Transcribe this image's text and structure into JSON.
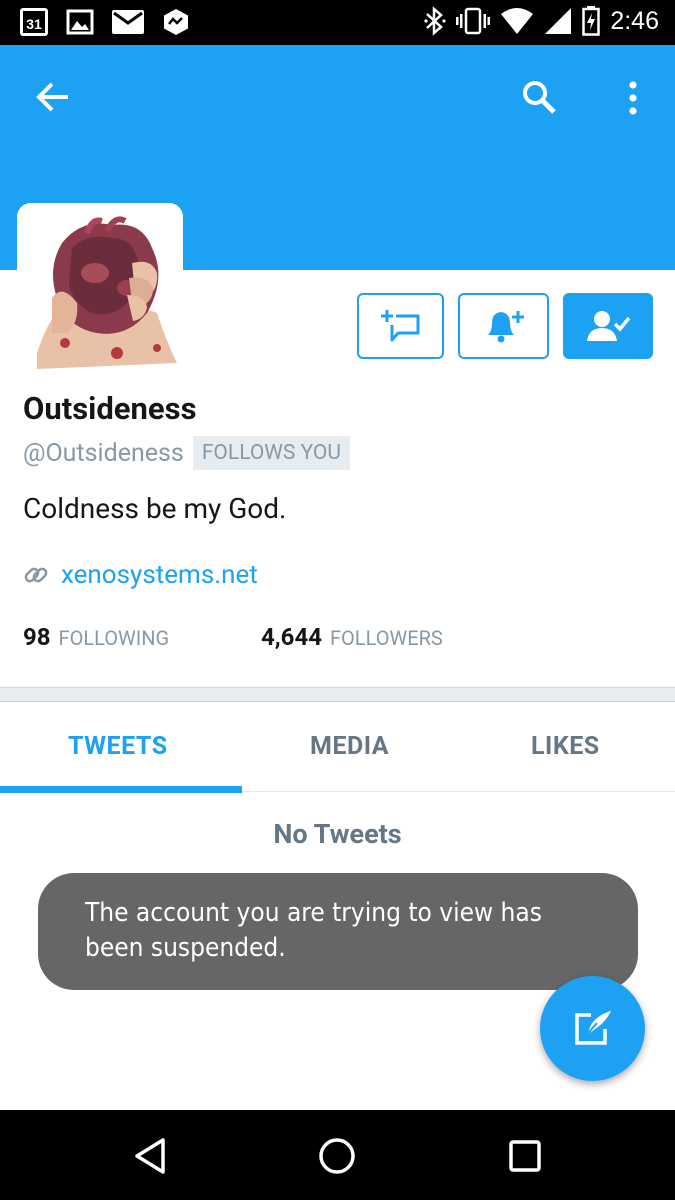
{
  "status_bar": {
    "calendar_day": "31",
    "time": "2:46",
    "left_icons": [
      "calendar-icon",
      "image-icon",
      "mail-icon",
      "messenger-icon"
    ],
    "right_icons": [
      "bluetooth-icon",
      "vibrate-icon",
      "wifi-icon",
      "signal-icon",
      "battery-charging-icon"
    ]
  },
  "header": {
    "background_color": "#1da1f2",
    "back_icon": "arrow-left-icon",
    "search_icon": "search-icon",
    "more_icon": "more-vert-icon"
  },
  "profile": {
    "avatar_description": "hand-holding-heart-image",
    "name": "Outsideness",
    "handle": "@Outsideness",
    "follows_you_badge": "FOLLOWS YOU",
    "bio": "Coldness be my God.",
    "website": "xenosystems.net",
    "following_count": "98",
    "following_label": "FOLLOWING",
    "followers_count": "4,644",
    "followers_label": "FOLLOWERS"
  },
  "actions": {
    "message_icon": "add-message-icon",
    "notifications_icon": "add-notification-icon",
    "following_icon": "following-user-check-icon"
  },
  "tabs": [
    {
      "label": "TWEETS",
      "active": true
    },
    {
      "label": "MEDIA",
      "active": false
    },
    {
      "label": "LIKES",
      "active": false
    }
  ],
  "empty_state": "No Tweets",
  "toast": "The account you are trying to view has been suspended.",
  "fab_icon": "compose-tweet-icon",
  "nav_bar": [
    "back-triangle-icon",
    "home-circle-icon",
    "recents-square-icon"
  ],
  "colors": {
    "accent": "#1da1f2",
    "text_primary": "#14171a",
    "text_secondary": "#8899a6",
    "toast_bg": "#666666"
  }
}
